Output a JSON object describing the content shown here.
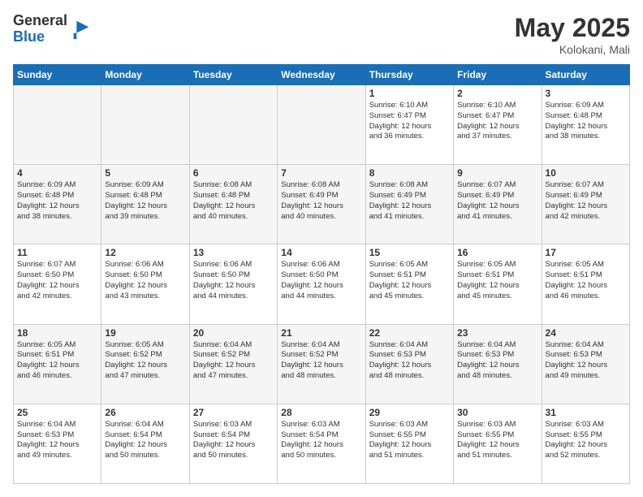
{
  "logo": {
    "general": "General",
    "blue": "Blue"
  },
  "header": {
    "month": "May 2025",
    "location": "Kolokani, Mali"
  },
  "weekdays": [
    "Sunday",
    "Monday",
    "Tuesday",
    "Wednesday",
    "Thursday",
    "Friday",
    "Saturday"
  ],
  "weeks": [
    [
      {
        "day": "",
        "empty": true
      },
      {
        "day": "",
        "empty": true
      },
      {
        "day": "",
        "empty": true
      },
      {
        "day": "",
        "empty": true
      },
      {
        "day": "1",
        "sunrise": "6:10 AM",
        "sunset": "6:47 PM",
        "daylight": "12 hours and 36 minutes."
      },
      {
        "day": "2",
        "sunrise": "6:10 AM",
        "sunset": "6:47 PM",
        "daylight": "12 hours and 37 minutes."
      },
      {
        "day": "3",
        "sunrise": "6:09 AM",
        "sunset": "6:48 PM",
        "daylight": "12 hours and 38 minutes."
      }
    ],
    [
      {
        "day": "4",
        "sunrise": "6:09 AM",
        "sunset": "6:48 PM",
        "daylight": "12 hours and 38 minutes."
      },
      {
        "day": "5",
        "sunrise": "6:09 AM",
        "sunset": "6:48 PM",
        "daylight": "12 hours and 39 minutes."
      },
      {
        "day": "6",
        "sunrise": "6:08 AM",
        "sunset": "6:48 PM",
        "daylight": "12 hours and 40 minutes."
      },
      {
        "day": "7",
        "sunrise": "6:08 AM",
        "sunset": "6:49 PM",
        "daylight": "12 hours and 40 minutes."
      },
      {
        "day": "8",
        "sunrise": "6:08 AM",
        "sunset": "6:49 PM",
        "daylight": "12 hours and 41 minutes."
      },
      {
        "day": "9",
        "sunrise": "6:07 AM",
        "sunset": "6:49 PM",
        "daylight": "12 hours and 41 minutes."
      },
      {
        "day": "10",
        "sunrise": "6:07 AM",
        "sunset": "6:49 PM",
        "daylight": "12 hours and 42 minutes."
      }
    ],
    [
      {
        "day": "11",
        "sunrise": "6:07 AM",
        "sunset": "6:50 PM",
        "daylight": "12 hours and 42 minutes."
      },
      {
        "day": "12",
        "sunrise": "6:06 AM",
        "sunset": "6:50 PM",
        "daylight": "12 hours and 43 minutes."
      },
      {
        "day": "13",
        "sunrise": "6:06 AM",
        "sunset": "6:50 PM",
        "daylight": "12 hours and 44 minutes."
      },
      {
        "day": "14",
        "sunrise": "6:06 AM",
        "sunset": "6:50 PM",
        "daylight": "12 hours and 44 minutes."
      },
      {
        "day": "15",
        "sunrise": "6:05 AM",
        "sunset": "6:51 PM",
        "daylight": "12 hours and 45 minutes."
      },
      {
        "day": "16",
        "sunrise": "6:05 AM",
        "sunset": "6:51 PM",
        "daylight": "12 hours and 45 minutes."
      },
      {
        "day": "17",
        "sunrise": "6:05 AM",
        "sunset": "6:51 PM",
        "daylight": "12 hours and 46 minutes."
      }
    ],
    [
      {
        "day": "18",
        "sunrise": "6:05 AM",
        "sunset": "6:51 PM",
        "daylight": "12 hours and 46 minutes."
      },
      {
        "day": "19",
        "sunrise": "6:05 AM",
        "sunset": "6:52 PM",
        "daylight": "12 hours and 47 minutes."
      },
      {
        "day": "20",
        "sunrise": "6:04 AM",
        "sunset": "6:52 PM",
        "daylight": "12 hours and 47 minutes."
      },
      {
        "day": "21",
        "sunrise": "6:04 AM",
        "sunset": "6:52 PM",
        "daylight": "12 hours and 48 minutes."
      },
      {
        "day": "22",
        "sunrise": "6:04 AM",
        "sunset": "6:53 PM",
        "daylight": "12 hours and 48 minutes."
      },
      {
        "day": "23",
        "sunrise": "6:04 AM",
        "sunset": "6:53 PM",
        "daylight": "12 hours and 48 minutes."
      },
      {
        "day": "24",
        "sunrise": "6:04 AM",
        "sunset": "6:53 PM",
        "daylight": "12 hours and 49 minutes."
      }
    ],
    [
      {
        "day": "25",
        "sunrise": "6:04 AM",
        "sunset": "6:53 PM",
        "daylight": "12 hours and 49 minutes."
      },
      {
        "day": "26",
        "sunrise": "6:04 AM",
        "sunset": "6:54 PM",
        "daylight": "12 hours and 50 minutes."
      },
      {
        "day": "27",
        "sunrise": "6:03 AM",
        "sunset": "6:54 PM",
        "daylight": "12 hours and 50 minutes."
      },
      {
        "day": "28",
        "sunrise": "6:03 AM",
        "sunset": "6:54 PM",
        "daylight": "12 hours and 50 minutes."
      },
      {
        "day": "29",
        "sunrise": "6:03 AM",
        "sunset": "6:55 PM",
        "daylight": "12 hours and 51 minutes."
      },
      {
        "day": "30",
        "sunrise": "6:03 AM",
        "sunset": "6:55 PM",
        "daylight": "12 hours and 51 minutes."
      },
      {
        "day": "31",
        "sunrise": "6:03 AM",
        "sunset": "6:55 PM",
        "daylight": "12 hours and 52 minutes."
      }
    ]
  ]
}
